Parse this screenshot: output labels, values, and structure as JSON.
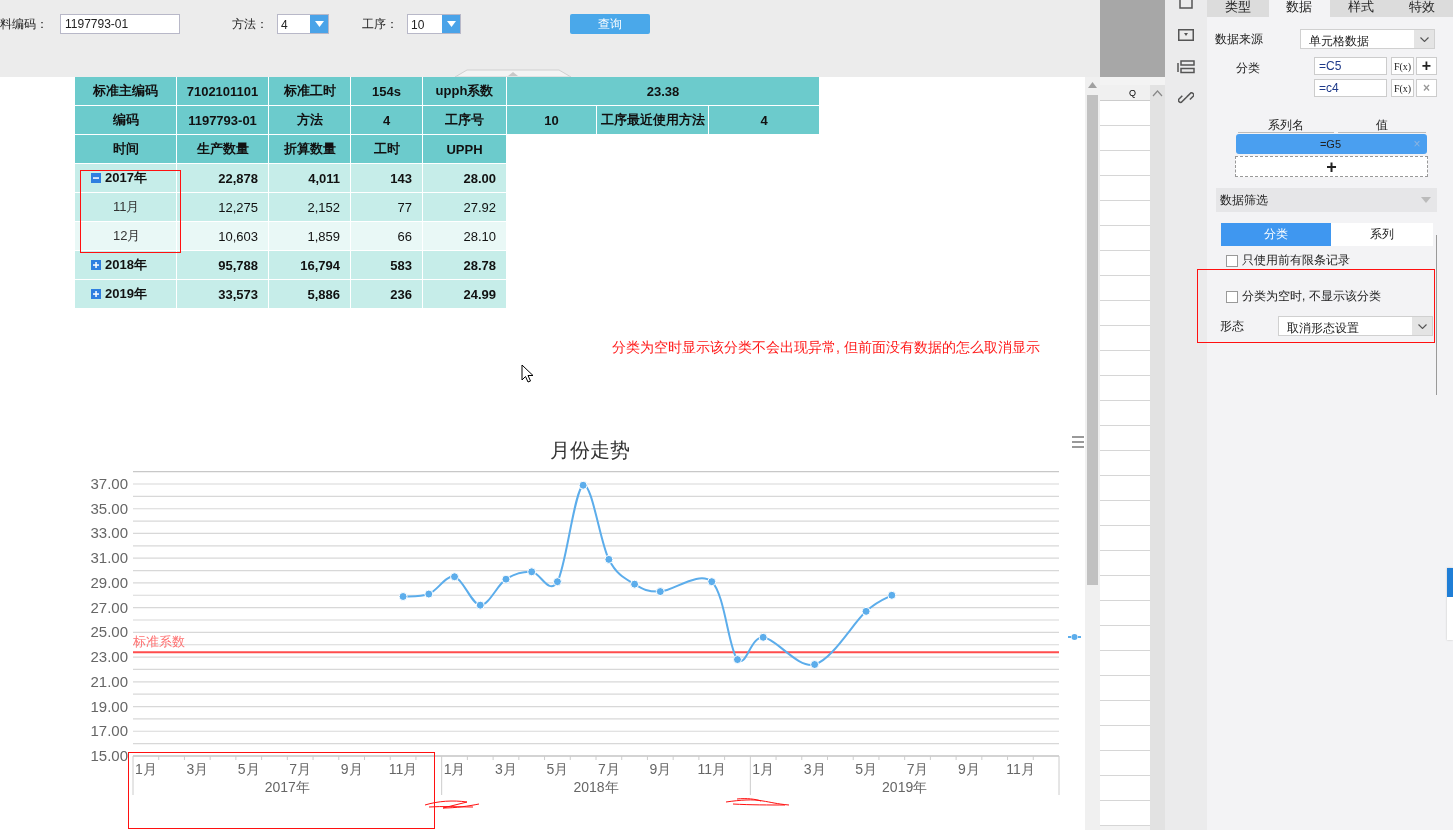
{
  "query_bar": {
    "fields": [
      {
        "kind": "text",
        "label": "料编码：",
        "value": "1197793-01"
      },
      {
        "kind": "select",
        "label": "方法：",
        "value": "4"
      },
      {
        "kind": "select",
        "label": "工序：",
        "value": "10"
      }
    ],
    "button": "查询"
  },
  "report_table": {
    "info_rows": [
      [
        "标准主编码",
        "7102101101",
        "标准工时",
        "154s",
        "upph系数",
        "23.38"
      ],
      [
        "编码",
        "1197793-01",
        "方法",
        "4",
        "工序号",
        "10",
        "工序最近使用方法",
        "4"
      ]
    ],
    "columns": [
      "时间",
      "生产数量",
      "折算数量",
      "工时",
      "UPPH"
    ],
    "rows": [
      {
        "label": "2017年",
        "values": [
          "22,878",
          "4,011",
          "143",
          "28.00"
        ],
        "expanded": true,
        "children": [
          {
            "label": "11月",
            "values": [
              "12,275",
              "2,152",
              "77",
              "27.92"
            ]
          },
          {
            "label": "12月",
            "values": [
              "10,603",
              "1,859",
              "66",
              "28.10"
            ]
          }
        ]
      },
      {
        "label": "2018年",
        "values": [
          "95,788",
          "16,794",
          "583",
          "28.78"
        ],
        "expanded": false
      },
      {
        "label": "2019年",
        "values": [
          "33,573",
          "5,886",
          "236",
          "24.99"
        ],
        "expanded": false
      }
    ]
  },
  "note": "分类为空时显示该分类不会出现异常, 但前面没有数据的怎么取消显示",
  "chart": {
    "year_labels": [
      "2017年",
      "2018年",
      "2019年"
    ],
    "chart_data": {
      "type": "line",
      "title": "月份走势",
      "grid": true,
      "categories": [
        "1月",
        null,
        "3月",
        null,
        "5月",
        null,
        "7月",
        null,
        "9月",
        null,
        "11月",
        null,
        "1月",
        null,
        "3月",
        null,
        "5月",
        null,
        "7月",
        null,
        "9月",
        null,
        "11月",
        null,
        "1月",
        null,
        "3月",
        null,
        "5月",
        null,
        "7月",
        null,
        "9月",
        null,
        "11月",
        null
      ],
      "series": [
        {
          "color": "#5cadeb",
          "marker": "circle",
          "values": [
            null,
            null,
            null,
            null,
            null,
            null,
            null,
            null,
            null,
            null,
            27.9,
            28.1,
            29.5,
            27.2,
            29.3,
            29.9,
            29.1,
            36.9,
            30.9,
            28.9,
            28.3,
            null,
            29.1,
            22.8,
            24.6,
            null,
            22.4,
            null,
            26.7,
            28.0,
            null,
            null,
            null,
            null,
            null,
            null
          ]
        }
      ],
      "ylim": [
        15,
        38
      ],
      "yticks": [
        {
          "value": 15,
          "label": "15.00"
        },
        {
          "value": 17,
          "label": "17.00"
        },
        {
          "value": 19,
          "label": "19.00"
        },
        {
          "value": 21,
          "label": "21.00"
        },
        {
          "value": 23,
          "label": "23.00"
        },
        {
          "value": 25,
          "label": "25.00"
        },
        {
          "value": 27,
          "label": "27.00"
        },
        {
          "value": 29,
          "label": "29.00"
        },
        {
          "value": 31,
          "label": "31.00"
        },
        {
          "value": 33,
          "label": "33.00"
        },
        {
          "value": 35,
          "label": "35.00"
        },
        {
          "value": 37,
          "label": "37.00"
        }
      ],
      "ref_lines": [
        {
          "axis": "y",
          "value": 23.4,
          "label": "标准系数",
          "color": "#ff4d4d"
        }
      ]
    }
  },
  "sheet": {
    "column_header": "Q"
  },
  "panel": {
    "tabs": [
      {
        "label": "类型",
        "selected": false
      },
      {
        "label": "数据",
        "selected": true
      },
      {
        "label": "样式",
        "selected": false
      },
      {
        "label": "特效",
        "selected": false
      }
    ],
    "data_source": {
      "label": "数据来源",
      "value": "单元格数据"
    },
    "category": {
      "label": "分类",
      "formulas": [
        {
          "value": "=C5",
          "fx": "F(x)",
          "action": "+"
        },
        {
          "value": "=c4",
          "fx": "F(x)",
          "action": "×"
        }
      ]
    },
    "series_table": {
      "columns": [
        "系列名",
        "值"
      ],
      "rows": [
        {
          "value": "=G5",
          "remove": "×"
        }
      ],
      "add": "+"
    },
    "filter": {
      "title": "数据筛选",
      "expanded": true,
      "tabs": [
        {
          "label": "分类",
          "selected": true
        },
        {
          "label": "系列",
          "selected": false
        }
      ],
      "options": [
        {
          "kind": "checkbox",
          "label": "只使用前有限条记录",
          "checked": false
        },
        {
          "kind": "checkbox",
          "label": "分类为空时, 不显示该分类",
          "checked": false
        },
        {
          "kind": "select",
          "label": "形态",
          "value": "取消形态设置"
        }
      ]
    }
  }
}
